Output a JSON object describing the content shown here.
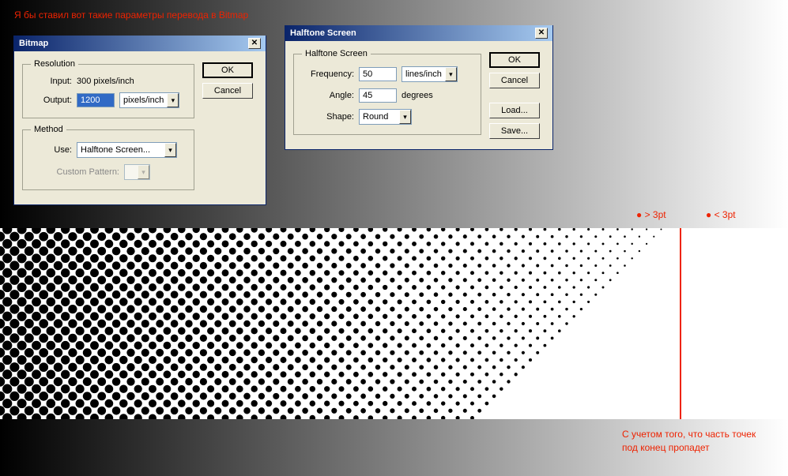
{
  "annotations": {
    "top": "Я бы ставил вот такие параметры перевода в Bitmap",
    "marker_a": "● > 3pt",
    "marker_b": "● < 3pt",
    "bottom_l1": "С учетом того, что часть точек",
    "bottom_l2": "под конец пропадет"
  },
  "bitmap_dialog": {
    "title": "Bitmap",
    "close": "✕",
    "buttons": {
      "ok": "OK",
      "cancel": "Cancel"
    },
    "resolution": {
      "legend": "Resolution",
      "input_label": "Input:",
      "input_value": "300 pixels/inch",
      "output_label": "Output:",
      "output_value": "1200",
      "output_unit": "pixels/inch"
    },
    "method": {
      "legend": "Method",
      "use_label": "Use:",
      "use_value": "Halftone Screen...",
      "custom_label": "Custom Pattern:"
    }
  },
  "halftone_dialog": {
    "title": "Halftone Screen",
    "close": "✕",
    "legend": "Halftone Screen",
    "buttons": {
      "ok": "OK",
      "cancel": "Cancel",
      "load": "Load...",
      "save": "Save..."
    },
    "frequency": {
      "label": "Frequency:",
      "value": "50",
      "unit": "lines/inch"
    },
    "angle": {
      "label": "Angle:",
      "value": "45",
      "unit": "degrees"
    },
    "shape": {
      "label": "Shape:",
      "value": "Round"
    }
  }
}
